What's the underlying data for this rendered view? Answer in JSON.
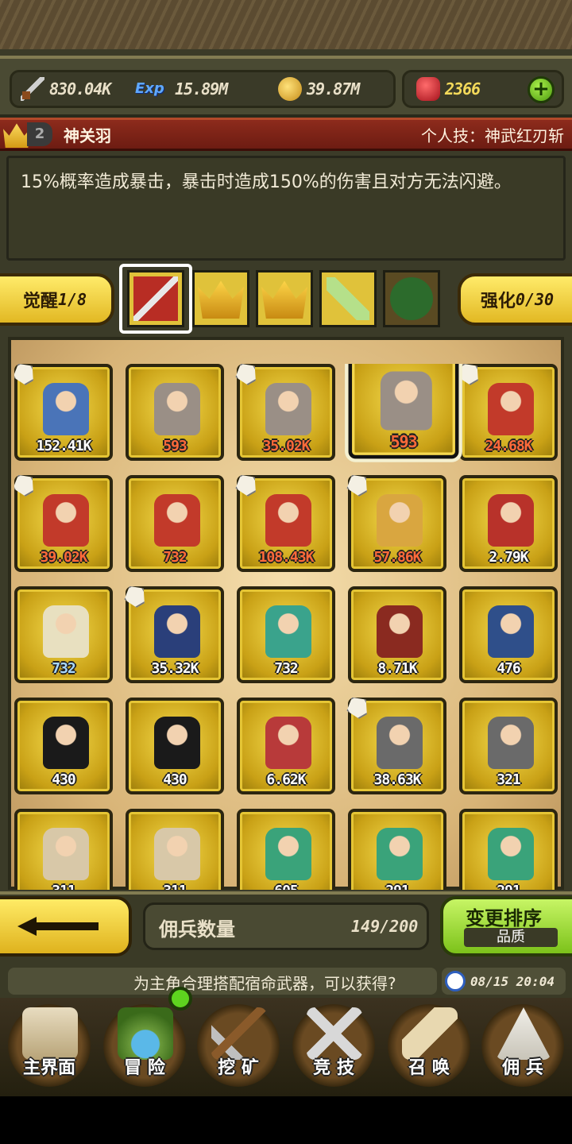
{
  "currencies": {
    "attack": {
      "icon": "sword-icon",
      "value": "830.04K"
    },
    "exp": {
      "icon": "exp-icon",
      "label": "Exp",
      "value": "15.89M"
    },
    "gold": {
      "icon": "coin-icon",
      "value": "39.87M"
    },
    "gems": {
      "icon": "ruby-icon",
      "value": "2366"
    },
    "add_icon": "plus-icon"
  },
  "hero": {
    "rank": "2",
    "name": "神关羽",
    "skill": "个人技：神武红刃斩",
    "description": "15%概率造成暴击，暴击时造成150%的伤害且对方无法闪避。"
  },
  "awaken": {
    "label": "觉醒",
    "value": "1/8"
  },
  "enhance": {
    "label": "强化",
    "value": "0/30"
  },
  "skill_slots": [
    "crossed-blades-icon",
    "crown-up-icon",
    "crown-up-icon",
    "glaive-icon",
    "scroll-icon"
  ],
  "mercenaries": [
    {
      "value": "152.41K",
      "tone": "white",
      "equipped": true,
      "color": "#4a74b8"
    },
    {
      "value": "593",
      "tone": "red",
      "equipped": false,
      "color": "#9a8f86"
    },
    {
      "value": "35.02K",
      "tone": "red",
      "equipped": true,
      "color": "#9a8f86"
    },
    {
      "value": "593",
      "tone": "red",
      "equipped": false,
      "color": "#9a8f86",
      "selected": true
    },
    {
      "value": "24.68K",
      "tone": "red",
      "equipped": true,
      "color": "#c23a2a"
    },
    {
      "value": "39.02K",
      "tone": "red",
      "equipped": true,
      "color": "#c23a2a"
    },
    {
      "value": "732",
      "tone": "red",
      "equipped": false,
      "color": "#c23a2a"
    },
    {
      "value": "108.43K",
      "tone": "red",
      "equipped": true,
      "color": "#c23a2a"
    },
    {
      "value": "57.86K",
      "tone": "red",
      "equipped": true,
      "color": "#d9a640"
    },
    {
      "value": "2.79K",
      "tone": "white",
      "equipped": false,
      "color": "#b8322a"
    },
    {
      "value": "732",
      "tone": "blue",
      "equipped": false,
      "color": "#e8e0c0"
    },
    {
      "value": "35.32K",
      "tone": "white",
      "equipped": true,
      "color": "#2a3f7a"
    },
    {
      "value": "732",
      "tone": "white",
      "equipped": false,
      "color": "#3aa38c"
    },
    {
      "value": "8.71K",
      "tone": "white",
      "equipped": false,
      "color": "#8a2a20"
    },
    {
      "value": "476",
      "tone": "white",
      "equipped": false,
      "color": "#2f4f8a"
    },
    {
      "value": "430",
      "tone": "white",
      "equipped": false,
      "color": "#1a1a1a"
    },
    {
      "value": "430",
      "tone": "white",
      "equipped": false,
      "color": "#1a1a1a"
    },
    {
      "value": "6.62K",
      "tone": "white",
      "equipped": false,
      "color": "#b83a3a"
    },
    {
      "value": "38.63K",
      "tone": "white",
      "equipped": true,
      "color": "#6a6a6a"
    },
    {
      "value": "321",
      "tone": "white",
      "equipped": false,
      "color": "#6a6a6a"
    },
    {
      "value": "311",
      "tone": "white",
      "equipped": false,
      "color": "#d8c8a8"
    },
    {
      "value": "311",
      "tone": "white",
      "equipped": false,
      "color": "#d8c8a8"
    },
    {
      "value": "605",
      "tone": "white",
      "equipped": false,
      "color": "#3aa37a"
    },
    {
      "value": "291",
      "tone": "white",
      "equipped": false,
      "color": "#3aa37a"
    },
    {
      "value": "291",
      "tone": "white",
      "equipped": false,
      "color": "#3aa37a"
    }
  ],
  "footer": {
    "count_label": "佣兵数量",
    "count_value": "149/200",
    "sort_label": "变更排序",
    "sort_sub": "品质"
  },
  "ticker": {
    "text": "为主角合理搭配宿命武器，可以获得?",
    "time": "08/15 20:04"
  },
  "nav": [
    {
      "label": "主界面",
      "icon": "map-icon"
    },
    {
      "label": "冒 险",
      "icon": "island-icon"
    },
    {
      "label": "挖 矿",
      "icon": "pickaxe-icon"
    },
    {
      "label": "竞 技",
      "icon": "crossed-swords-icon"
    },
    {
      "label": "召 唤",
      "icon": "scroll-icon"
    },
    {
      "label": "佣 兵",
      "icon": "tent-icon"
    }
  ]
}
